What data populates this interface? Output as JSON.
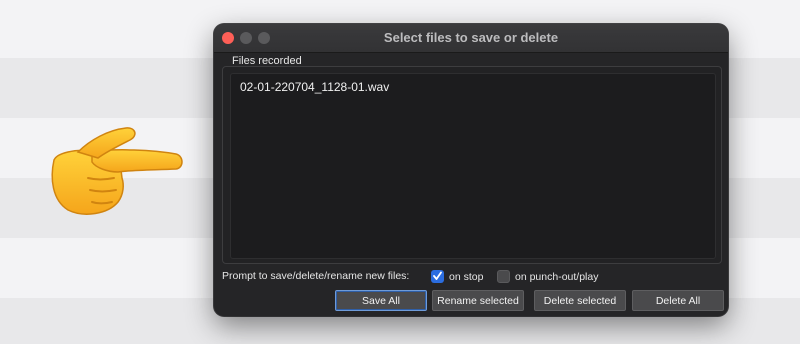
{
  "window": {
    "title": "Select files to save or delete"
  },
  "files_group": {
    "label": "Files recorded",
    "items": [
      {
        "name": "02-01-220704_1128-01.wav"
      }
    ]
  },
  "prompt": {
    "label": "Prompt to save/delete/rename new files:",
    "options": [
      {
        "label": "on stop",
        "checked": true
      },
      {
        "label": "on punch-out/play",
        "checked": false
      }
    ]
  },
  "buttons": {
    "save_all": "Save All",
    "rename_selected": "Rename selected",
    "delete_selected": "Delete selected",
    "delete_all": "Delete All"
  },
  "colors": {
    "accent": "#2b6de0",
    "close_light": "#fe5f57",
    "window_bg": "#252527"
  },
  "icons": {
    "pointer": "backhand-index-pointing-right-icon"
  }
}
